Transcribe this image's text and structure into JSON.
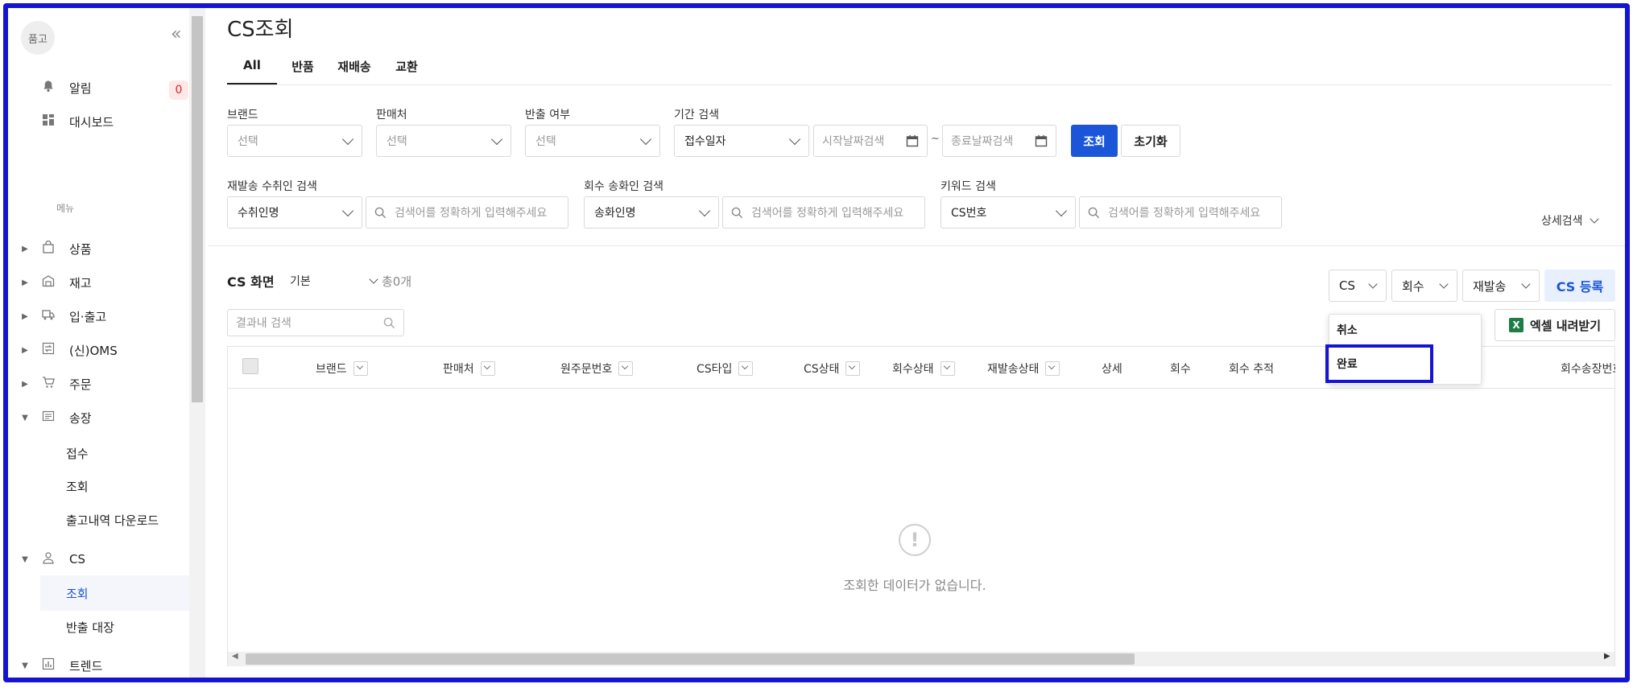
{
  "sidebar": {
    "logo": "품고",
    "collapse_icon": "«",
    "alarm": {
      "label": "알림",
      "count": "0"
    },
    "dashboard": "대시보드",
    "menu_caption": "메뉴",
    "items": [
      {
        "label": "상품"
      },
      {
        "label": "재고"
      },
      {
        "label": "입·출고"
      },
      {
        "label": "(신)OMS"
      },
      {
        "label": "주문"
      },
      {
        "label": "송장"
      },
      {
        "label": "CS"
      },
      {
        "label": "트렌드"
      }
    ],
    "songjang_sub": [
      "접수",
      "조회",
      "출고내역 다운로드"
    ],
    "cs_sub": [
      "조회",
      "반출 대장"
    ]
  },
  "page": {
    "title": "CS조회",
    "tabs": [
      "All",
      "반품",
      "재배송",
      "교환"
    ]
  },
  "filters": {
    "brand": {
      "label": "브랜드",
      "value": "선택"
    },
    "seller": {
      "label": "판매처",
      "value": "선택"
    },
    "return": {
      "label": "반출 여부",
      "value": "선택"
    },
    "period": {
      "label": "기간 검색",
      "value": "접수일자",
      "start_placeholder": "시작날짜검색",
      "sep": "~",
      "end_placeholder": "종료날짜검색"
    },
    "search_button": "조회",
    "reset_button": "초기화",
    "reship_receiver": {
      "label": "재발송 수취인 검색",
      "value": "수취인명",
      "placeholder": "검색어를 정확하게 입력해주세요"
    },
    "return_sender": {
      "label": "회수 송화인 검색",
      "value": "송화인명",
      "placeholder": "검색어를 정확하게 입력해주세요"
    },
    "keyword": {
      "label": "키워드 검색",
      "value": "CS번호",
      "placeholder": "검색어를 정확하게 입력해주세요"
    },
    "advanced": "상세검색"
  },
  "results": {
    "screen_label": "CS 화면",
    "view": "기본",
    "total": "총0개",
    "search_placeholder": "결과내 검색",
    "dropdowns": [
      "CS",
      "회수",
      "재발송"
    ],
    "register_button": "CS 등록",
    "excel_button": "엑셀 내려받기",
    "cs_menu_options": [
      "취소",
      "완료"
    ],
    "columns": [
      "브랜드",
      "판매처",
      "원주문번호",
      "CS타입",
      "CS상태",
      "회수상태",
      "재발송상태",
      "상세",
      "회수",
      "회수 추적",
      "회수송장번호"
    ],
    "empty_message": "조회한 데이터가 없습니다."
  },
  "colors": {
    "accent": "#1b56d8",
    "highlight": "#1414d2",
    "badge": "#e02424"
  }
}
